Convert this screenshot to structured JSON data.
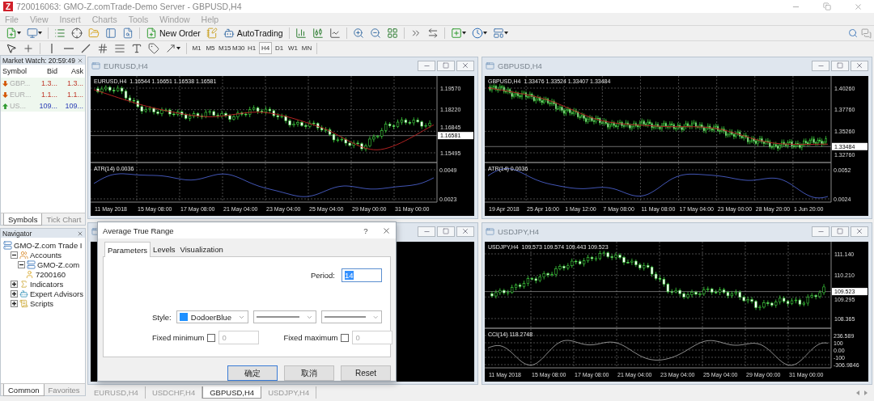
{
  "title_bar": {
    "logo": "Z",
    "title": "720016063: GMO-Z.comTrade-Demo Server - GBPUSD,H4"
  },
  "menu": [
    "File",
    "View",
    "Insert",
    "Charts",
    "Tools",
    "Window",
    "Help"
  ],
  "toolbar": {
    "buttons": [
      "New Order",
      "AutoTrading"
    ],
    "timeframes": [
      {
        "label": "M1",
        "selected": false
      },
      {
        "label": "M5",
        "selected": false
      },
      {
        "label": "M15",
        "selected": false
      },
      {
        "label": "M30",
        "selected": false
      },
      {
        "label": "H1",
        "selected": false
      },
      {
        "label": "H4",
        "selected": true
      },
      {
        "label": "D1",
        "selected": false
      },
      {
        "label": "W1",
        "selected": false
      },
      {
        "label": "MN",
        "selected": false
      }
    ]
  },
  "market_watch": {
    "title": "Market Watch: 20:59:49",
    "columns": [
      "Symbol",
      "Bid",
      "Ask"
    ],
    "rows": [
      {
        "symbol": "GBP...",
        "bid": "1.3...",
        "ask": "1.3...",
        "kind": "down",
        "color": "#d35400"
      },
      {
        "symbol": "EUR...",
        "bid": "1.1...",
        "ask": "1.1...",
        "kind": "down",
        "color": "#d35400"
      },
      {
        "symbol": "US...",
        "bid": "109...",
        "ask": "109...",
        "kind": "up",
        "color": "#2e9a2e"
      }
    ],
    "tabs": [
      {
        "label": "Symbols",
        "selected": true
      },
      {
        "label": "Tick Chart",
        "selected": false
      }
    ]
  },
  "navigator": {
    "title": "Navigator",
    "tree": [
      {
        "label": "GMO-Z.com Trade I",
        "kind": "server",
        "children": [
          {
            "label": "Accounts",
            "kind": "accounts",
            "expanded": true,
            "children": [
              {
                "label": "GMO-Z.com",
                "kind": "server",
                "expanded": true,
                "children": [
                  {
                    "label": "7200160",
                    "kind": "account"
                  }
                ]
              }
            ]
          },
          {
            "label": "Indicators",
            "kind": "indicators",
            "expanded": false
          },
          {
            "label": "Expert Advisors",
            "kind": "experts",
            "expanded": false
          },
          {
            "label": "Scripts",
            "kind": "scripts",
            "expanded": false
          }
        ]
      }
    ],
    "tabs": [
      {
        "label": "Common",
        "selected": true
      },
      {
        "label": "Favorites",
        "selected": false
      }
    ]
  },
  "charts": [
    {
      "kind": "chart",
      "title": "EURUSD,H4",
      "header": "EURUSD,H4  1.16544 1.16651 1.16538 1.16581",
      "moving_average": true,
      "price_ticks": [
        "1.19570",
        "1.18220",
        "1.16845",
        "1.15495"
      ],
      "current_price": "1.16581",
      "indicator": {
        "kind": "atr",
        "label": "ATR(14) 0.0036",
        "ticks": [
          "0.0049",
          "0.0023"
        ]
      },
      "time_labels": [
        "11 May 2018",
        "15 May 08:00",
        "17 May 08:00",
        "21 May 04:00",
        "23 May 04:00",
        "25 May 04:00",
        "29 May 00:00",
        "31 May 00:00"
      ]
    },
    {
      "kind": "chart",
      "title": "GBPUSD,H4",
      "header": "GBPUSD,H4  1.33476 1.33524 1.33407 1.33484",
      "moving_average": true,
      "price_ticks": [
        "1.40260",
        "1.37760",
        "1.35260",
        "1.32760"
      ],
      "current_price": "1.33484",
      "indicator": {
        "kind": "atr",
        "label": "ATR(14) 0.0036",
        "ticks": [
          "0.0052",
          "0.0024"
        ]
      },
      "time_labels": [
        "19 Apr 2018",
        "25 Apr 16:00",
        "1 May 12:00",
        "7 May 08:00",
        "11 May 08:00",
        "17 May 04:00",
        "23 May 00:00",
        "28 May 20:00",
        "1 Jun 20:00"
      ]
    },
    {
      "kind": "empty"
    },
    {
      "kind": "chart",
      "title": "USDJPY,H4",
      "header": "USDJPY,H4  109.573 109.574 109.443 109.523",
      "moving_average": false,
      "price_ticks": [
        "111.140",
        "110.210",
        "109.295",
        "108.365"
      ],
      "current_price": "109.523",
      "indicator": {
        "kind": "cci",
        "label": "CCI(14) 118.2748",
        "ticks": [
          "236.589",
          "100",
          "0.00",
          "-100",
          "-306.9846"
        ]
      },
      "time_labels": [
        "11 May 2018",
        "15 May 08:00",
        "17 May 08:00",
        "21 May 04:00",
        "23 May 04:00",
        "25 May 04:00",
        "29 May 00:00",
        "31 May 00:00"
      ]
    }
  ],
  "dialog": {
    "title": "Average True Range",
    "help": "?",
    "tabs": [
      {
        "label": "Parameters",
        "selected": true
      },
      {
        "label": "Levels",
        "selected": false
      },
      {
        "label": "Visualization",
        "selected": false
      }
    ],
    "period": {
      "label": "Period:",
      "value": "14",
      "highlighted": true
    },
    "style": {
      "label": "Style:",
      "color_name": "DodoerBlue",
      "color": "#1e90ff"
    },
    "fixed_minimum": {
      "label": "Fixed minimum",
      "checked": false,
      "value": "0",
      "disabled": true
    },
    "fixed_maximum": {
      "label": "Fixed maximum",
      "checked": false,
      "value": "0",
      "disabled": true
    },
    "buttons": [
      {
        "label": "确定",
        "default": true
      },
      {
        "label": "取消",
        "default": false
      },
      {
        "label": "Reset",
        "default": false
      }
    ]
  },
  "chart_tabs": [
    {
      "label": "EURUSD,H4",
      "selected": false
    },
    {
      "label": "USDCHF,H4",
      "selected": false
    },
    {
      "label": "GBPUSD,H4",
      "selected": true
    },
    {
      "label": "USDJPY,H4",
      "selected": false
    }
  ]
}
